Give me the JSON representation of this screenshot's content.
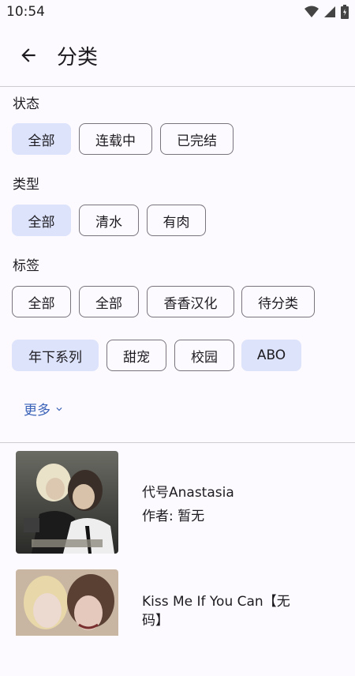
{
  "status_bar": {
    "time": "10:54",
    "icons": [
      "wifi-icon",
      "signal-icon",
      "battery-icon"
    ]
  },
  "header": {
    "title": "分类",
    "back_icon": "arrow-left-icon"
  },
  "filters": {
    "status": {
      "label": "状态",
      "chips": [
        {
          "label": "全部",
          "selected": true
        },
        {
          "label": "连载中",
          "selected": false
        },
        {
          "label": "已完结",
          "selected": false
        }
      ]
    },
    "type": {
      "label": "类型",
      "chips": [
        {
          "label": "全部",
          "selected": true
        },
        {
          "label": "清水",
          "selected": false
        },
        {
          "label": "有肉",
          "selected": false
        }
      ]
    },
    "tags": {
      "label": "标签",
      "chips": [
        {
          "label": "全部",
          "selected": false
        },
        {
          "label": "全部",
          "selected": false
        },
        {
          "label": "香香汉化",
          "selected": false
        },
        {
          "label": "待分类",
          "selected": false
        },
        {
          "label": "年下系列",
          "selected": true
        },
        {
          "label": "甜宠",
          "selected": false
        },
        {
          "label": "校园",
          "selected": false
        },
        {
          "label": "ABO",
          "selected": true
        }
      ]
    },
    "more_label": "更多"
  },
  "results": [
    {
      "title": "代号Anastasia",
      "author": "作者: 暂无"
    },
    {
      "title": "Kiss Me If You Can【无码】",
      "author": ""
    }
  ],
  "colors": {
    "selected_chip": "#dce3fb",
    "accent": "#3b63b8",
    "background": "#fdfaff",
    "outline": "#79747e"
  }
}
